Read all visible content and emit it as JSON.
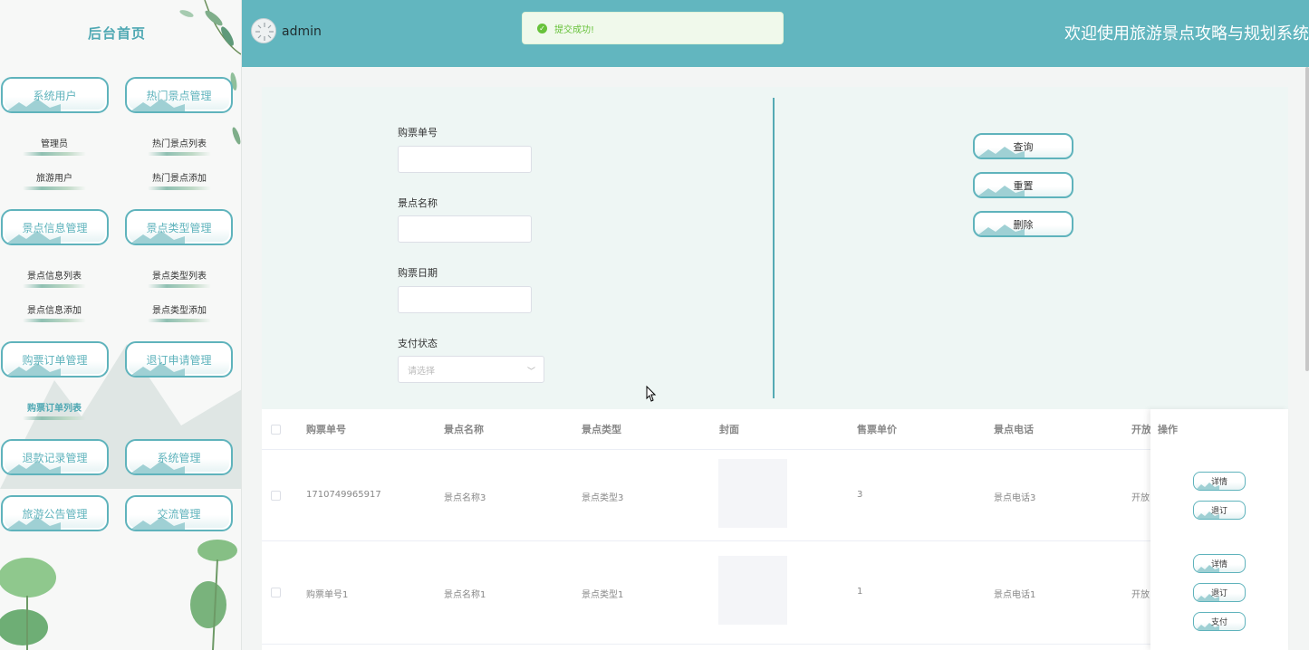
{
  "sidebar": {
    "title": "后台首页",
    "groups": [
      {
        "label": "系统用户",
        "items": [
          "管理员",
          "旅游用户"
        ]
      },
      {
        "label": "热门景点管理",
        "items": [
          "热门景点列表",
          "热门景点添加"
        ]
      },
      {
        "label": "景点信息管理",
        "items": [
          "景点信息列表",
          "景点信息添加"
        ]
      },
      {
        "label": "景点类型管理",
        "items": [
          "景点类型列表",
          "景点类型添加"
        ]
      },
      {
        "label": "购票订单管理",
        "items": [
          "购票订单列表"
        ]
      },
      {
        "label": "退订申请管理",
        "items": []
      },
      {
        "label": "退款记录管理",
        "items": []
      },
      {
        "label": "系统管理",
        "items": []
      },
      {
        "label": "旅游公告管理",
        "items": []
      },
      {
        "label": "交流管理",
        "items": []
      }
    ]
  },
  "header": {
    "username": "admin",
    "welcome": "欢迎使用旅游景点攻略与规划系统",
    "bg_color": "#62b6bf"
  },
  "toast": {
    "message": "提交成功!",
    "icon": "check-circle-icon",
    "color": "#67c23a"
  },
  "search": {
    "fields": [
      {
        "label": "购票单号",
        "value": ""
      },
      {
        "label": "景点名称",
        "value": ""
      },
      {
        "label": "购票日期",
        "value": ""
      }
    ],
    "status": {
      "label": "支付状态",
      "placeholder": "请选择"
    },
    "buttons": [
      "查询",
      "重置",
      "删除"
    ]
  },
  "table": {
    "columns": [
      "购票单号",
      "景点名称",
      "景点类型",
      "封面",
      "售票单价",
      "景点电话",
      "开放",
      "操作"
    ],
    "rows": [
      {
        "order_no": "1710749965917",
        "name": "景点名称3",
        "type": "景点类型3",
        "price": "3",
        "phone": "景点电话3",
        "open": "开放",
        "actions": [
          "详情",
          "退订"
        ]
      },
      {
        "order_no": "购票单号1",
        "name": "景点名称1",
        "type": "景点类型1",
        "price": "1",
        "phone": "景点电话1",
        "open": "开放",
        "actions": [
          "详情",
          "退订",
          "支付"
        ]
      }
    ]
  },
  "colors": {
    "accent": "#5fb3bc",
    "panel": "#eef6f4"
  }
}
